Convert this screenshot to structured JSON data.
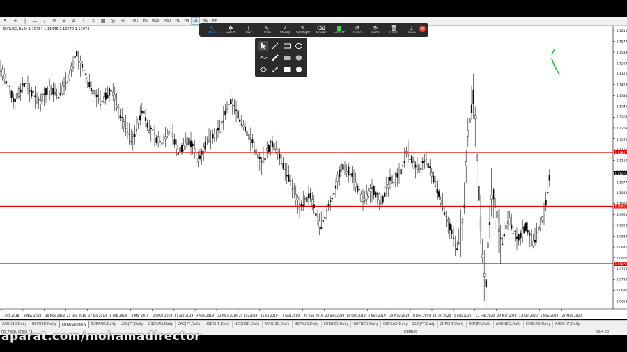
{
  "toolbar": {
    "timeframes": [
      "M1",
      "M5",
      "M15",
      "M30",
      "H1",
      "H4",
      "D1",
      "W1",
      "MN"
    ],
    "active_timeframe": "D1"
  },
  "chart": {
    "symbol_label": "EURUSD,Daily  1.10764 1.11446 1.10670 1.11074",
    "price_labels": [
      "1.16160",
      "1.15775",
      "1.15390",
      "1.15005",
      "1.14620",
      "1.14235",
      "1.13850",
      "1.13465",
      "1.13080",
      "1.12695",
      "1.12310",
      "1.11925",
      "1.11540",
      "1.11155",
      "1.10770",
      "1.10385",
      "1.10000",
      "1.09615",
      "1.09230",
      "1.08845",
      "1.08460",
      "1.08075",
      "1.07690",
      "1.07305",
      "1.06920",
      "1.06535"
    ],
    "date_labels": [
      "1 Oct 2018",
      "8 Nov 2018",
      "30 Nov 2018",
      "24 Dec 2018",
      "17 Jan 2019",
      "8 Feb 2019",
      "4 Mar 2019",
      "26 Mar 2019",
      "17 Apr 2019",
      "9 May 2019",
      "31 May 2019",
      "24 Jun 2019",
      "16 Jul 2019",
      "7 Aug 2019",
      "29 Aug 2019",
      "20 Sep 2019",
      "14 Oct 2019",
      "5 Nov 2019",
      "27 Nov 2019",
      "19 Dec 2019",
      "14 Jan 2020",
      "5 Feb 2020",
      "27 Feb 2020",
      "20 Mar 2020",
      "13 Apr 2020",
      "5 May 2020",
      "27 May 2020"
    ],
    "levels": [
      {
        "price_label": "1.11847",
        "color": "#e00000"
      },
      {
        "price_label": "1.09952",
        "color": "#e00000"
      },
      {
        "price_label": "1.07876",
        "color": "#e00000"
      }
    ],
    "current_price_label": "1.11074",
    "annotation_color": "#1fbf3a"
  },
  "zoom_toolbar": {
    "tools": [
      {
        "icon": "cursor-icon",
        "label": "Mouse"
      },
      {
        "icon": "move-icon",
        "label": "Select"
      },
      {
        "icon": "text-icon",
        "label": "Text"
      },
      {
        "icon": "squiggle-icon",
        "label": "Draw"
      },
      {
        "icon": "stamp-icon",
        "label": "Stamp"
      },
      {
        "icon": "spotlight-icon",
        "label": "Spotlight"
      },
      {
        "icon": "eraser-icon",
        "label": "Eraser"
      },
      {
        "icon": "format-icon",
        "label": "Format"
      },
      {
        "icon": "undo-icon",
        "label": "Undo"
      },
      {
        "icon": "redo-icon",
        "label": "Redo"
      },
      {
        "icon": "trash-icon",
        "label": "Clear"
      },
      {
        "icon": "save-icon",
        "label": "Save"
      }
    ],
    "format_color": "#3cd25a",
    "close_color": "#e0463d"
  },
  "draw_palette": {
    "items": [
      "select-icon",
      "line-icon",
      "rectangle-outline-icon",
      "ellipse-outline-icon",
      "squiggle-icon",
      "pen-icon",
      "rectangle-highlight-icon",
      "ellipse-highlight-icon",
      "diamond-icon",
      "double-arrow-icon",
      "rectangle-filled-icon",
      "ellipse-filled-icon"
    ]
  },
  "tabs": [
    "XAUUSD,Daily",
    "GBPUSD,Daily",
    "EURUSD,Daily",
    "EURAUD,Daily",
    "USDJPY,Daily",
    "USDCAD,Daily",
    "CADJPY,Daily",
    "USDCHF,Daily",
    "NZDUSD,Daily",
    "AUDUSD,Daily",
    "GBPAUD,Daily",
    "EURNZD,Daily",
    "GBPNZD,Daily",
    "GBPCAD,Daily",
    "EURJPY,Daily",
    "GBPCHF,Daily",
    "GBPJPY,Daily",
    "AUDNZD,Daily",
    "EURCAD,Daily",
    "AUDCHF,Daily"
  ],
  "active_tab": "EURUSD,Daily",
  "status": {
    "help": "For Help, press F1",
    "profile": "Default",
    "connection": "58/4 kb"
  },
  "watermark": "aparat.com/mohamadirector"
}
